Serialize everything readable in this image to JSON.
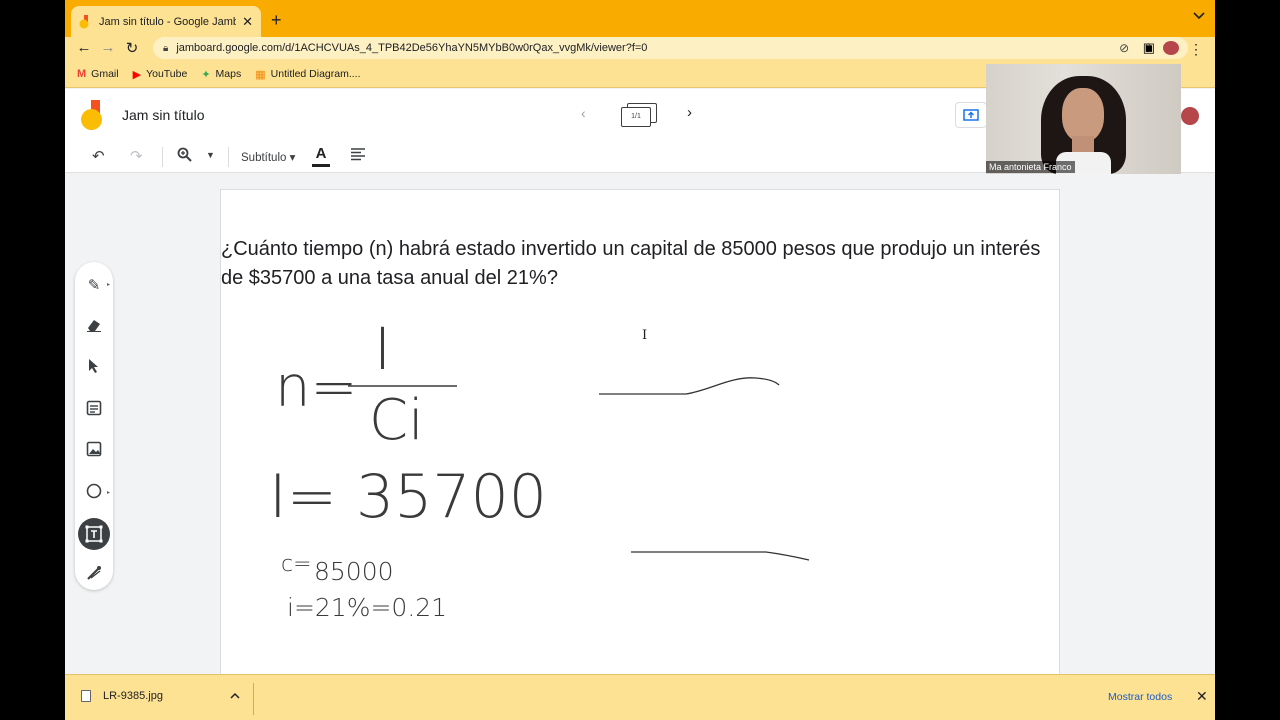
{
  "browser": {
    "tab_title": "Jam sin título - Google Jamboard",
    "tab_close": "✕",
    "new_tab": "+",
    "url": "jamboard.google.com/d/1ACHCVUAs_4_TPB42De56YhaYN5MYbB0w0rQax_vvgMk/viewer?f=0",
    "bookmarks": [
      {
        "label": "Gmail",
        "icon": "gmail-icon",
        "color": "#ea4335"
      },
      {
        "label": "YouTube",
        "icon": "youtube-icon",
        "color": "#ff0000"
      },
      {
        "label": "Maps",
        "icon": "maps-icon",
        "color": "#34a853"
      },
      {
        "label": "Untitled Diagram....",
        "icon": "drawio-icon",
        "color": "#f08705"
      }
    ]
  },
  "jamboard": {
    "title": "Jam sin título",
    "page_indicator": "1/1",
    "font_label": "Subtítulo",
    "accent": "#fbbc04"
  },
  "frame": {
    "question": "¿Cuánto tiempo (n) habrá estado invertido un capital de 85000 pesos que produjo un interés de $35700 a una tasa anual del 21%?",
    "formula_lhs": "n=",
    "formula_num": "I",
    "formula_den": "Ci",
    "i_value": "I= 35700",
    "c_label": "c=",
    "c_value": "85000",
    "rate": "i=21%=0.21"
  },
  "video": {
    "participant_name": "Ma antonieta Franco"
  },
  "downloads": {
    "file_name": "LR-9385.jpg",
    "show_all": "Mostrar todos"
  }
}
